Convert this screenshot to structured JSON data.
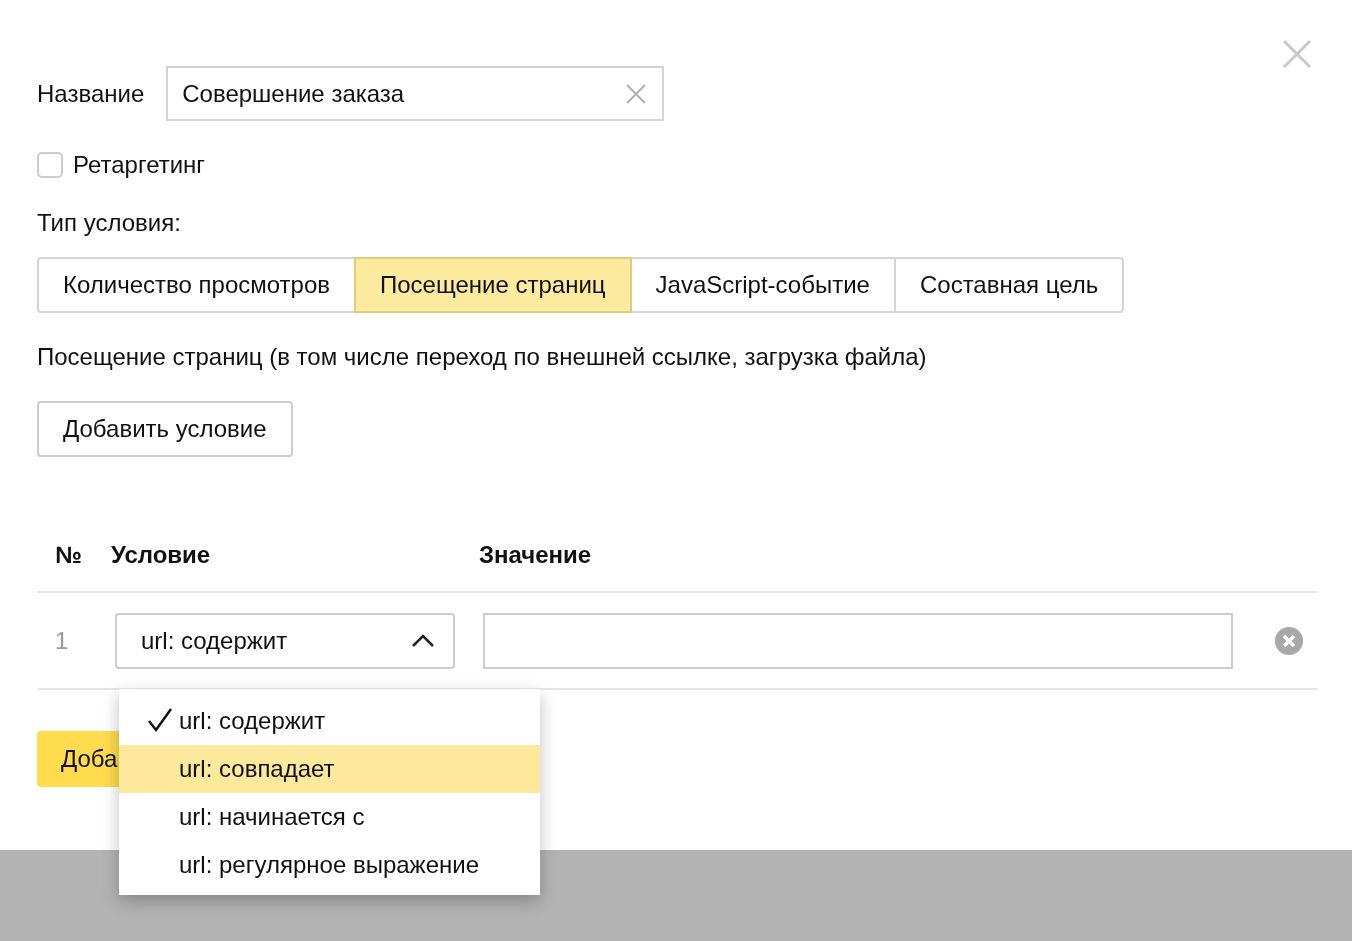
{
  "dialog": {
    "name_label": "Название",
    "name_value": "Совершение заказа",
    "retargeting": {
      "label": "Ретаргетинг",
      "checked": false
    },
    "condition_type_label": "Тип условия:",
    "condition_types": [
      {
        "label": "Количество просмотров",
        "selected": false
      },
      {
        "label": "Посещение страниц",
        "selected": true
      },
      {
        "label": "JavaScript-событие",
        "selected": false
      },
      {
        "label": "Составная цель",
        "selected": false
      }
    ],
    "description": "Посещение страниц (в том числе переход по внешней ссылке, загрузка файла)",
    "add_condition_button": "Добавить условие",
    "table": {
      "columns": [
        "№",
        "Условие",
        "Значение"
      ],
      "rows": [
        {
          "number": "1",
          "condition": "url: содержит",
          "expanded": true
        }
      ]
    },
    "condition_options": [
      {
        "label": "url: содержит",
        "selected": true,
        "highlighted": false
      },
      {
        "label": "url: совпадает",
        "selected": false,
        "highlighted": true
      },
      {
        "label": "url: начинается с",
        "selected": false,
        "highlighted": false
      },
      {
        "label": "url: регулярное выражение",
        "selected": false,
        "highlighted": false
      }
    ],
    "submit_button": "Доба"
  }
}
